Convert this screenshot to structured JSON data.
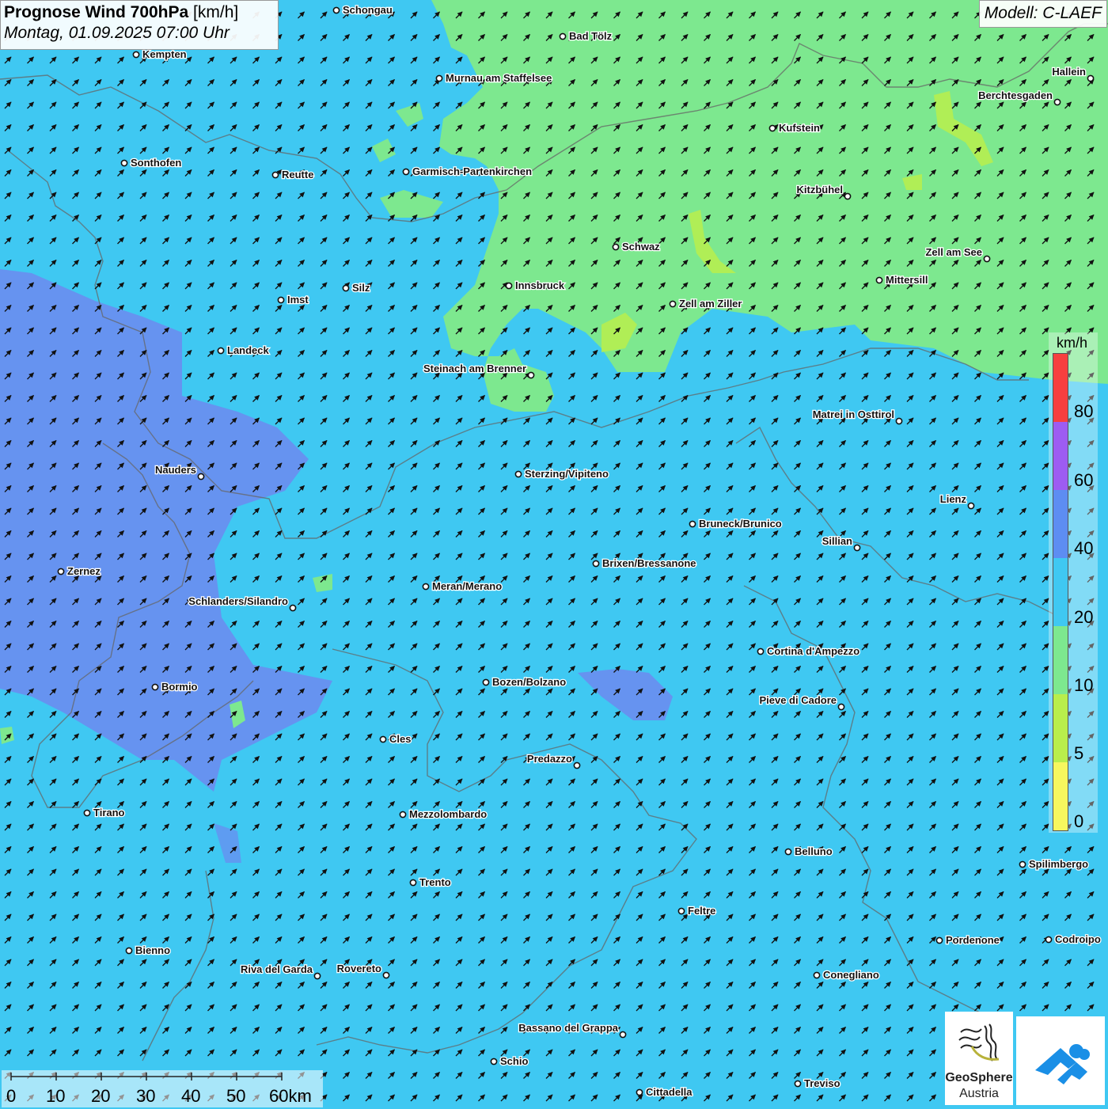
{
  "title": {
    "main": "Prognose Wind 700hPa",
    "unit": "[km/h]",
    "date": "Montag, 01.09.2025 07:00 Uhr"
  },
  "model": "Modell: C-LAEF",
  "legend": {
    "unit": "km/h",
    "ticks": [
      "80",
      "60",
      "40",
      "20",
      "10",
      "5",
      "0"
    ],
    "colors_top_to_bottom": [
      "#f73f3f",
      "#9d5cf2",
      "#5d8df2",
      "#3fc8f2",
      "#7de88f",
      "#b9ee4c",
      "#f7f75e"
    ]
  },
  "scale": {
    "labels": [
      "0",
      "10",
      "20",
      "30",
      "40",
      "50",
      "60km"
    ]
  },
  "logos": {
    "geosphere_name": "GeoSphere",
    "geosphere_country": "Austria"
  },
  "cities": [
    {
      "name": "Schongau"
    },
    {
      "name": "Bad Tölz"
    },
    {
      "name": "Kempten"
    },
    {
      "name": "Murnau am Staffelsee"
    },
    {
      "name": "Hallein"
    },
    {
      "name": "Berchtesgaden"
    },
    {
      "name": "Kufstein"
    },
    {
      "name": "Sonthofen"
    },
    {
      "name": "Reutte"
    },
    {
      "name": "Garmisch-Partenkirchen"
    },
    {
      "name": "Kitzbühel"
    },
    {
      "name": "Schwaz"
    },
    {
      "name": "Zell am See"
    },
    {
      "name": "Mittersill"
    },
    {
      "name": "Innsbruck"
    },
    {
      "name": "Silz"
    },
    {
      "name": "Imst"
    },
    {
      "name": "Zell am Ziller"
    },
    {
      "name": "Landeck"
    },
    {
      "name": "Steinach am Brenner"
    },
    {
      "name": "Matrei in Osttirol"
    },
    {
      "name": "Nauders"
    },
    {
      "name": "Sterzing/Vipiteno"
    },
    {
      "name": "Lienz"
    },
    {
      "name": "Bruneck/Brunico"
    },
    {
      "name": "Sillian"
    },
    {
      "name": "Brixen/Bressanone"
    },
    {
      "name": "Zernez"
    },
    {
      "name": "Meran/Merano"
    },
    {
      "name": "Schlanders/Silandro"
    },
    {
      "name": "Cortina d'Ampezzo"
    },
    {
      "name": "Bozen/Bolzano"
    },
    {
      "name": "Bormio"
    },
    {
      "name": "Pieve di Cadore"
    },
    {
      "name": "Cles"
    },
    {
      "name": "Predazzo"
    },
    {
      "name": "Tirano"
    },
    {
      "name": "Mezzolombardo"
    },
    {
      "name": "Belluno"
    },
    {
      "name": "Spilimbergo"
    },
    {
      "name": "Trento"
    },
    {
      "name": "Feltre"
    },
    {
      "name": "Pordenone"
    },
    {
      "name": "Codroipo"
    },
    {
      "name": "Bienno"
    },
    {
      "name": "Riva del Garda"
    },
    {
      "name": "Rovereto"
    },
    {
      "name": "Conegliano"
    },
    {
      "name": "Bassano del Grappa"
    },
    {
      "name": "Schio"
    },
    {
      "name": "Treviso"
    },
    {
      "name": "Cittadella"
    }
  ],
  "wind": {
    "direction": "from south-west",
    "arrow_color": "#111111"
  }
}
